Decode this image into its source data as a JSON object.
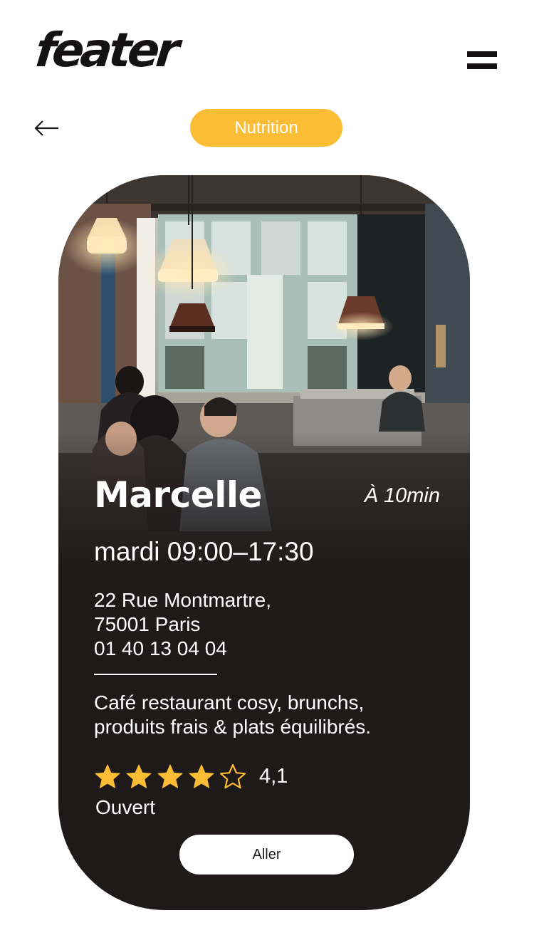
{
  "app": {
    "logo_text": "feater"
  },
  "header": {
    "category_label": "Nutrition"
  },
  "venue": {
    "name": "Marcelle",
    "distance": "À 10min",
    "hours": "mardi 09:00–17:30",
    "address_line1": "22 Rue Montmartre,",
    "address_line2": "75001 Paris",
    "phone": "01 40 13 04 04",
    "description_line1": "Café restaurant cosy, brunchs,",
    "description_line2": "produits frais & plats équilibrés.",
    "rating": 4.1,
    "rating_label": "4,1",
    "rating_max": 5,
    "status": "Ouvert",
    "go_label": "Aller"
  },
  "colors": {
    "accent": "#fbbd36",
    "card": "#1e1a19",
    "text_light": "#ffffff"
  },
  "icons": {
    "menu": "hamburger-icon",
    "back": "arrow-left-icon",
    "star_filled": "star-filled-icon",
    "star_empty": "star-outline-icon"
  }
}
